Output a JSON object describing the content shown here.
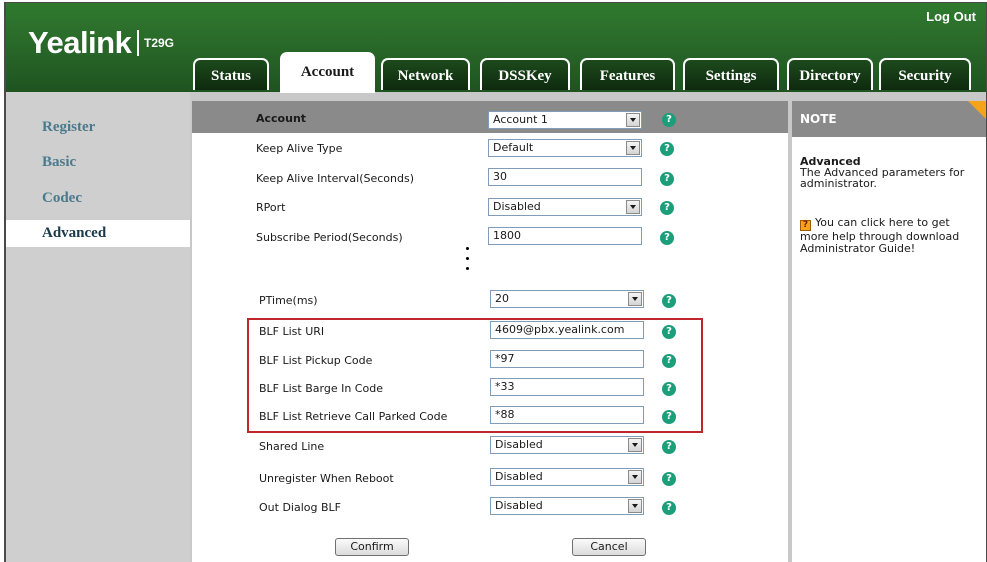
{
  "header": {
    "logo": "Yealink",
    "model": "T29G",
    "logout_label": "Log Out"
  },
  "tabs": [
    {
      "label": "Status",
      "active": false
    },
    {
      "label": "Account",
      "active": true
    },
    {
      "label": "Network",
      "active": false
    },
    {
      "label": "DSSKey",
      "active": false
    },
    {
      "label": "Features",
      "active": false
    },
    {
      "label": "Settings",
      "active": false
    },
    {
      "label": "Directory",
      "active": false
    },
    {
      "label": "Security",
      "active": false
    }
  ],
  "sidebar": {
    "items": [
      {
        "label": "Register",
        "active": false
      },
      {
        "label": "Basic",
        "active": false
      },
      {
        "label": "Codec",
        "active": false
      },
      {
        "label": "Advanced",
        "active": true
      }
    ]
  },
  "form": {
    "account": {
      "label": "Account",
      "value": "Account 1"
    },
    "rows": [
      {
        "label": "Keep Alive Type",
        "type": "select",
        "value": "Default"
      },
      {
        "label": "Keep Alive Interval(Seconds)",
        "type": "input",
        "value": "30"
      },
      {
        "label": "RPort",
        "type": "select",
        "value": "Disabled"
      },
      {
        "label": "Subscribe Period(Seconds)",
        "type": "input",
        "value": "1800"
      },
      {
        "label": "PTime(ms)",
        "type": "select",
        "value": "20"
      },
      {
        "label": "BLF List URI",
        "type": "input",
        "value": "4609@pbx.yealink.com"
      },
      {
        "label": "BLF List Pickup Code",
        "type": "input",
        "value": "*97"
      },
      {
        "label": "BLF List Barge In Code",
        "type": "input",
        "value": "*33"
      },
      {
        "label": "BLF List Retrieve Call Parked Code",
        "type": "input",
        "value": "*88"
      },
      {
        "label": "Shared Line",
        "type": "select",
        "value": "Disabled"
      },
      {
        "label": "Unregister When Reboot",
        "type": "select",
        "value": "Disabled"
      },
      {
        "label": "Out Dialog BLF",
        "type": "select",
        "value": "Disabled"
      }
    ],
    "help_glyph": "?",
    "confirm_label": "Confirm",
    "cancel_label": "Cancel"
  },
  "note": {
    "title": "NOTE",
    "subtitle": "Advanced",
    "description": "The Advanced parameters for administrator.",
    "help_text": "You can click here to get more help through download Administrator Guide!",
    "help_icon_glyph": "?"
  },
  "colors": {
    "header_green": "#2a6b2a",
    "help_icon": "#1c9e7a",
    "highlight_border": "#c0272d",
    "note_corner": "#f5a31a"
  }
}
